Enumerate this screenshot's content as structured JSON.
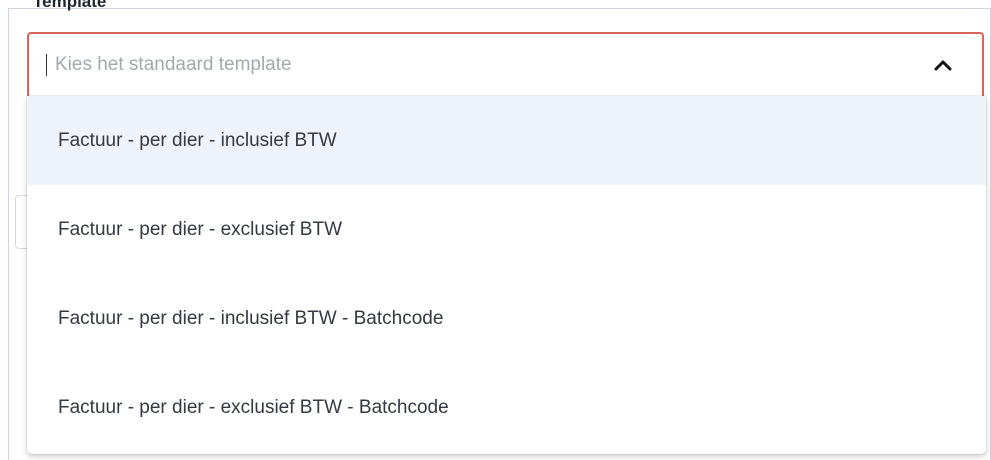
{
  "field": {
    "label": "Template",
    "placeholder": "Kies het standaard template",
    "value": ""
  },
  "icons": {
    "toggle": "chevron-up-icon"
  },
  "options": [
    {
      "label": "Factuur - per dier - inclusief BTW",
      "highlighted": true
    },
    {
      "label": "Factuur - per dier - exclusief BTW",
      "highlighted": false
    },
    {
      "label": "Factuur - per dier - inclusief BTW - Batchcode",
      "highlighted": false
    },
    {
      "label": "Factuur - per dier - exclusief BTW - Batchcode",
      "highlighted": false
    }
  ],
  "colors": {
    "error_border": "#d9625c",
    "highlight_bg": "#eef4fa",
    "text": "#333a42",
    "placeholder": "#a3a9b0"
  }
}
